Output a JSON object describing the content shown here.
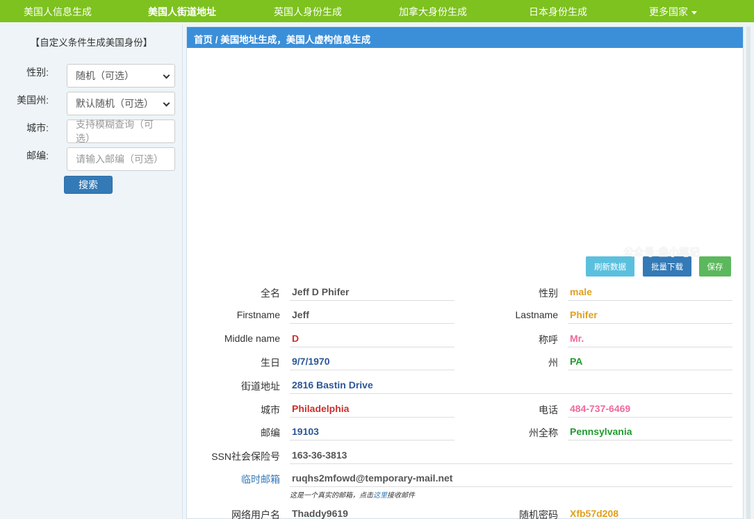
{
  "nav": {
    "items": [
      "美国人信息生成",
      "美国人街道地址",
      "英国人身份生成",
      "加拿大身份生成",
      "日本身份生成",
      "更多国家"
    ]
  },
  "sidebar": {
    "title": "【自定义条件生成美国身份】",
    "gender_label": "性别:",
    "gender_value": "随机（可选）",
    "state_label": "美国州:",
    "state_value": "默认随机（可选）",
    "city_label": "城市:",
    "city_placeholder": "支持模糊查询（可选）",
    "zip_label": "邮编:",
    "zip_placeholder": "请输入邮编（可选）",
    "search_label": "搜索"
  },
  "main": {
    "breadcrumb": "首页 / 美国地址生成，美国人虚构信息生成",
    "buttons": {
      "refresh": "刷新数据",
      "batch": "批量下载",
      "save": "保存"
    },
    "watermark": "公众号:叁小笔记",
    "fields": {
      "fullname_label": "全名",
      "fullname": "Jeff D Phifer",
      "gender_label": "性别",
      "gender": "male",
      "firstname_label": "Firstname",
      "firstname": "Jeff",
      "lastname_label": "Lastname",
      "lastname": "Phifer",
      "middlename_label": "Middle name",
      "middlename": "D",
      "title_label": "称呼",
      "title": "Mr.",
      "birthday_label": "生日",
      "birthday": "9/7/1970",
      "state_label": "州",
      "state": "PA",
      "street_label": "街道地址",
      "street": "2816 Bastin Drive",
      "city_label": "城市",
      "city": "Philadelphia",
      "phone_label": "电话",
      "phone": "484-737-6469",
      "zip_label": "邮编",
      "zip": "19103",
      "statefull_label": "州全称",
      "statefull": "Pennsylvania",
      "ssn_label": "SSN社会保险号",
      "ssn": "163-36-3813",
      "email_label": "临时邮箱",
      "email": "ruqhs2mfowd@temporary-mail.net",
      "email_note_pre": "这是一个真实的邮箱，点击",
      "email_note_link": "这里",
      "email_note_post": "接收邮件",
      "username_label": "网络用户名",
      "username": "Thaddy9619",
      "password_label": "随机密码",
      "password": "Xfb57d208"
    }
  },
  "colors": {
    "nav_bg": "#7dc21e",
    "header_bg": "#3b8fd9",
    "accent_blue": "#337ab7"
  }
}
